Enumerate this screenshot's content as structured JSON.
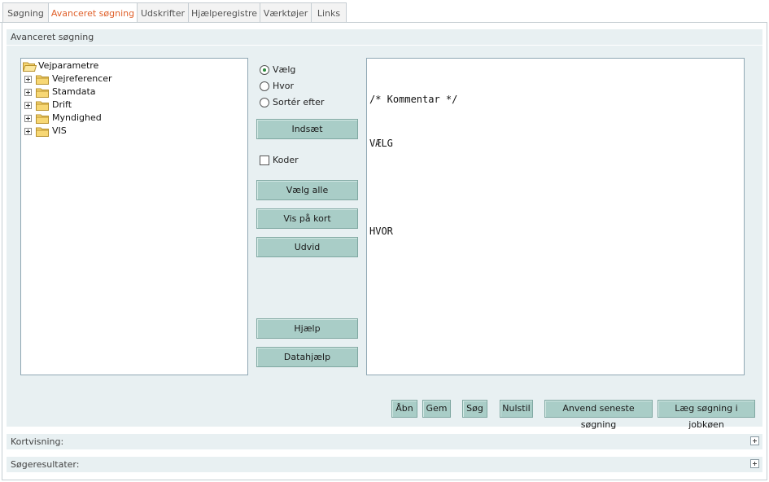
{
  "tabs": [
    {
      "label": "Søgning",
      "active": false
    },
    {
      "label": "Avanceret søgning",
      "active": true
    },
    {
      "label": "Udskrifter",
      "active": false
    },
    {
      "label": "Hjælperegistre",
      "active": false
    },
    {
      "label": "Værktøjer",
      "active": false
    },
    {
      "label": "Links",
      "active": false
    }
  ],
  "panel": {
    "title": "Avanceret søgning"
  },
  "tree": {
    "root": "Vejparametre",
    "children": [
      "Vejreferencer",
      "Stamdata",
      "Drift",
      "Myndighed",
      "VIS"
    ]
  },
  "options": {
    "radios": [
      {
        "label": "Vælg",
        "selected": true
      },
      {
        "label": "Hvor",
        "selected": false
      },
      {
        "label": "Sortér efter",
        "selected": false
      }
    ],
    "insert_button": "Indsæt",
    "codes_checkbox": {
      "label": "Koder",
      "checked": false
    },
    "buttons": [
      "Vælg alle",
      "Vis på kort",
      "Udvid"
    ],
    "help_buttons": [
      "Hjælp",
      "Datahjælp"
    ]
  },
  "editor": {
    "lines": [
      "/* Kommentar */",
      "VÆLG",
      "",
      "HVOR"
    ]
  },
  "actions": [
    "Åbn",
    "Gem",
    "Søg",
    "Nulstil",
    "Anvend seneste søgning",
    "Læg søgning i jobkøen"
  ],
  "sections": [
    {
      "label": "Kortvisning:"
    },
    {
      "label": "Søgeresultater:"
    }
  ],
  "colors": {
    "accent": "#e0602a",
    "button": "#a9cdc7",
    "panel": "#e8f0f2"
  }
}
